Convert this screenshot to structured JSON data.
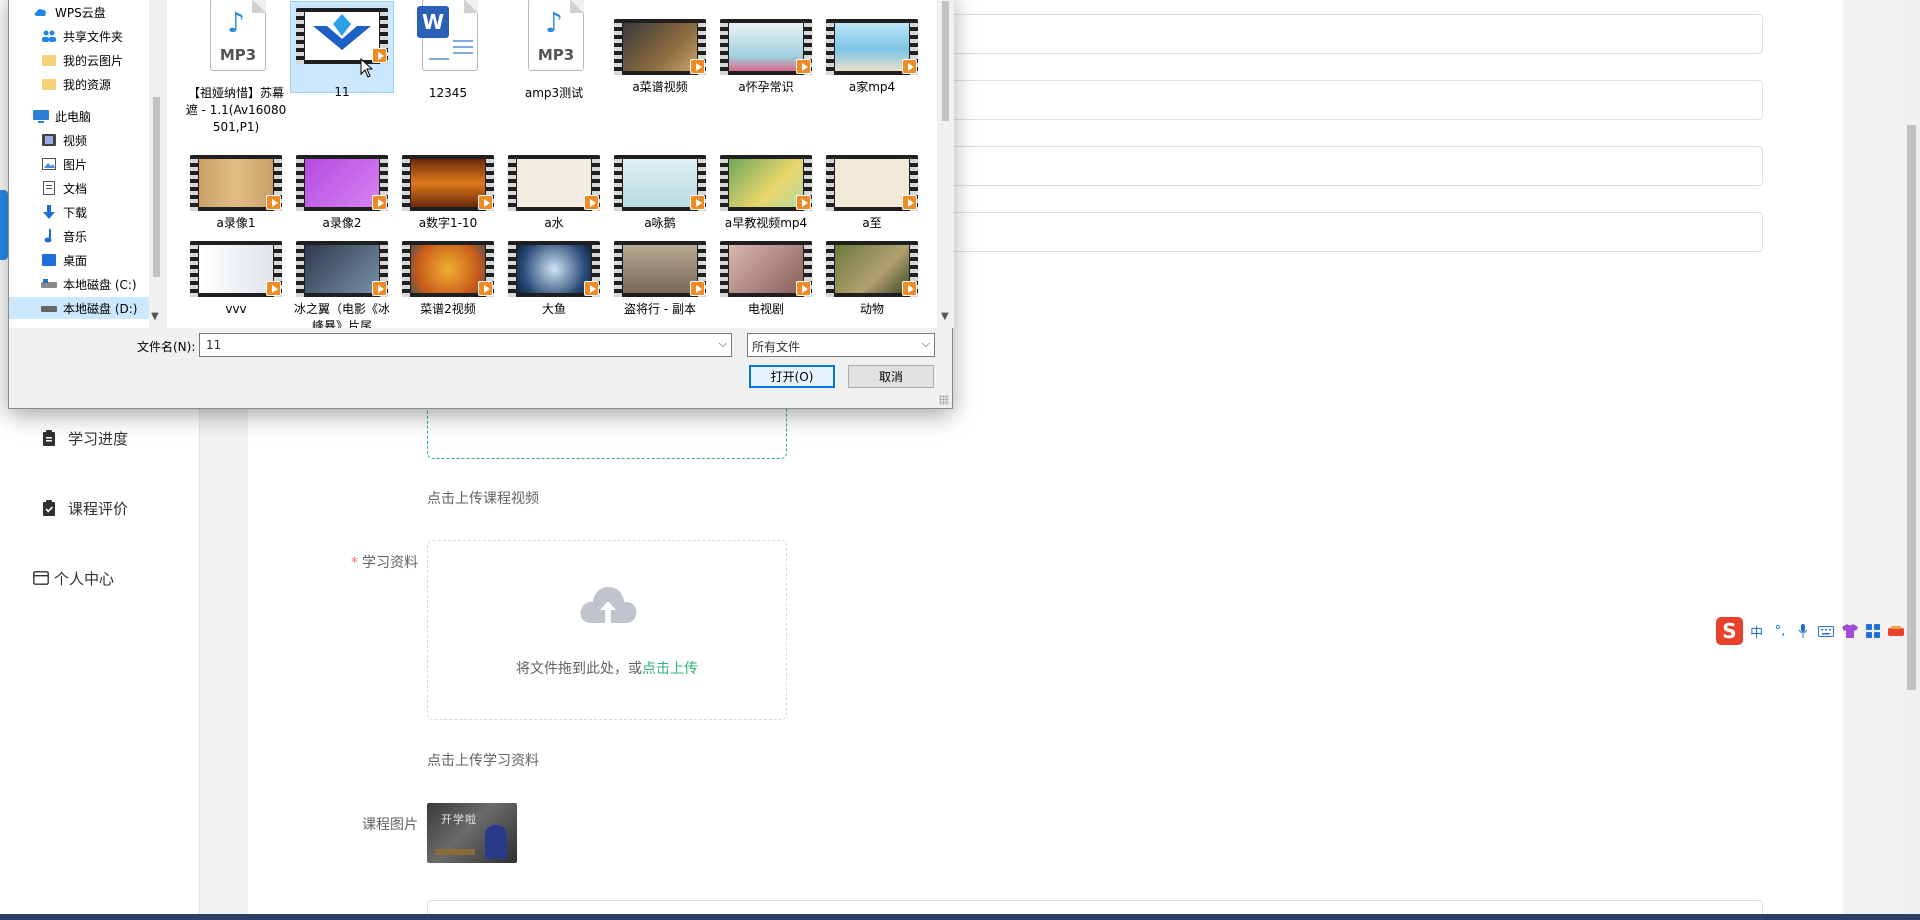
{
  "dialog": {
    "nav_items": [
      {
        "label": "WPS云盘",
        "icon": "cloud-icon"
      },
      {
        "label": "共享文件夹",
        "icon": "users-icon"
      },
      {
        "label": "我的云图片",
        "icon": "folder-icon"
      },
      {
        "label": "我的资源",
        "icon": "folder-icon"
      },
      {
        "label": "此电脑",
        "icon": "computer-icon"
      },
      {
        "label": "视频",
        "icon": "video-icon"
      },
      {
        "label": "图片",
        "icon": "picture-icon"
      },
      {
        "label": "文档",
        "icon": "document-icon"
      },
      {
        "label": "下载",
        "icon": "download-icon"
      },
      {
        "label": "音乐",
        "icon": "music-icon"
      },
      {
        "label": "桌面",
        "icon": "desktop-icon"
      },
      {
        "label": "本地磁盘 (C:)",
        "icon": "drive-icon"
      },
      {
        "label": "本地磁盘 (D:)",
        "icon": "drive-icon"
      }
    ],
    "files": [
      {
        "name": "【祖娅纳惜】苏幕遮 - 1.1(Av16080501,P1)",
        "kind": "mp3"
      },
      {
        "name": "11",
        "kind": "video"
      },
      {
        "name": "12345",
        "kind": "word"
      },
      {
        "name": "amp3测试",
        "kind": "mp3"
      },
      {
        "name": "a菜谱视频",
        "kind": "video"
      },
      {
        "name": "a怀孕常识",
        "kind": "video"
      },
      {
        "name": "a家mp4",
        "kind": "video"
      },
      {
        "name": "a录像1",
        "kind": "video"
      },
      {
        "name": "a录像2",
        "kind": "video"
      },
      {
        "name": "a数字1-10",
        "kind": "video"
      },
      {
        "name": "a水",
        "kind": "video"
      },
      {
        "name": "a咏鹅",
        "kind": "video"
      },
      {
        "name": "a早教视频mp4",
        "kind": "video"
      },
      {
        "name": "a至",
        "kind": "video"
      },
      {
        "name": "vvv",
        "kind": "video"
      },
      {
        "name": "冰之翼（电影《冰峰暴》片尾",
        "kind": "video"
      },
      {
        "name": "菜谱2视频",
        "kind": "video"
      },
      {
        "name": "大鱼",
        "kind": "video"
      },
      {
        "name": "盗将行 - 副本",
        "kind": "video"
      },
      {
        "name": "电视剧",
        "kind": "video"
      },
      {
        "name": "动物",
        "kind": "video"
      }
    ],
    "mp3_label": "MP3",
    "word_badge": "W",
    "filename_label": "文件名(N):",
    "filename_value": "11",
    "filetype_value": "所有文件",
    "open_button": "打开(O)",
    "cancel_button": "取消"
  },
  "sidebar": {
    "items": [
      {
        "label": "学习进度",
        "icon": "clipboard-icon"
      },
      {
        "label": "课程评价",
        "icon": "clipboard-check-icon"
      },
      {
        "label": "个人中心",
        "icon": "id-card-icon"
      }
    ]
  },
  "form": {
    "video_hint": "点击上传课程视频",
    "material_label": "学习资料",
    "material_required": "*",
    "upload_text": "将文件拖到此处，或",
    "upload_link": "点击上传",
    "material_hint": "点击上传学习资料",
    "image_label": "课程图片",
    "image_caption": "开学啦"
  },
  "ime": {
    "logo": "S",
    "items": [
      "中",
      "°,",
      "mic-icon",
      "keyboard-icon",
      "shirt-icon",
      "apps-icon",
      "tool-icon"
    ],
    "lang": "中",
    "punct": "°,"
  },
  "colors": {
    "accent_green": "#2bb673",
    "required_red": "#f56c6c",
    "active_blue": "#2d8cf0",
    "dialog_bg": "#f0f0f0",
    "selection_blue": "#cce8ff"
  }
}
